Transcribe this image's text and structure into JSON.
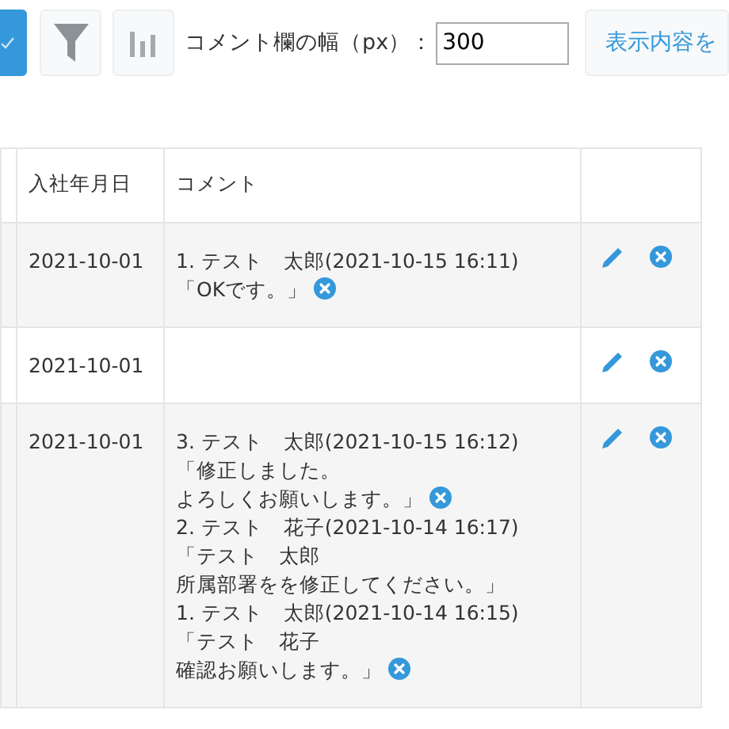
{
  "toolbar": {
    "width_label": "コメント欄の幅（px）：",
    "width_value": "300",
    "apply_button": "表示内容を"
  },
  "table": {
    "columns": [
      "入社年月日",
      "コメント"
    ],
    "rows": [
      {
        "hire_date": "2021-10-01",
        "comments": [
          {
            "header": "1. テスト　太郎(2021-10-15 16:11)",
            "lines": [
              "「OKです。」"
            ],
            "deletable": true
          }
        ]
      },
      {
        "hire_date": "2021-10-01",
        "comments": []
      },
      {
        "hire_date": "2021-10-01",
        "comments": [
          {
            "header": "3. テスト　太郎(2021-10-15 16:12)",
            "lines": [
              "「修正しました。",
              "よろしくお願いします。」"
            ],
            "deletable": true
          },
          {
            "header": "2. テスト　花子(2021-10-14 16:17)",
            "lines": [
              "「テスト　太郎",
              "所属部署をを修正してください。」"
            ],
            "deletable": false
          },
          {
            "header": "1. テスト　太郎(2021-10-14 16:15)",
            "lines": [
              "「テスト　花子",
              "確認お願いします。」"
            ],
            "deletable": true
          }
        ]
      }
    ]
  }
}
